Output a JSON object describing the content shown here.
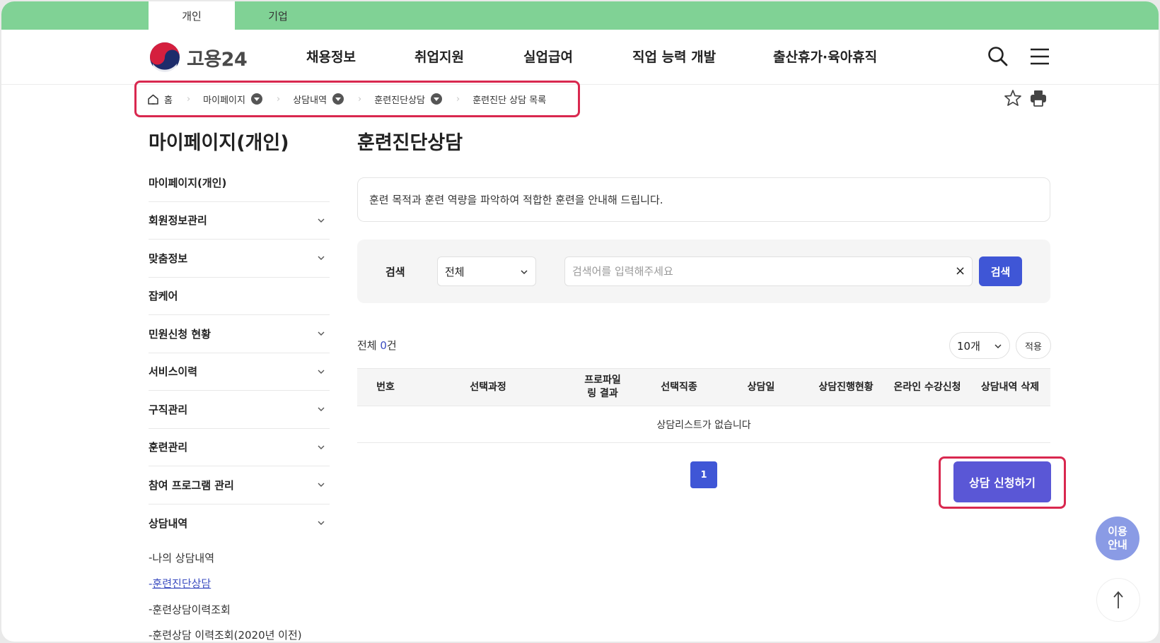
{
  "top_tabs": [
    "개인",
    "기업"
  ],
  "logo": {
    "text": "고용24"
  },
  "gnb": [
    "채용정보",
    "취업지원",
    "실업급여",
    "직업 능력 개발",
    "출산휴가·육아휴직"
  ],
  "breadcrumb": [
    "홈",
    "마이페이지",
    "상담내역",
    "훈련진단상담",
    "훈련진단 상담 목록"
  ],
  "sidebar": {
    "title": "마이페이지(개인)",
    "items": [
      {
        "label": "마이페이지(개인)"
      },
      {
        "label": "회원정보관리"
      },
      {
        "label": "맞춤정보"
      },
      {
        "label": "잡케어"
      },
      {
        "label": "민원신청 현황"
      },
      {
        "label": "서비스이력"
      },
      {
        "label": "구직관리"
      },
      {
        "label": "훈련관리"
      },
      {
        "label": "참여 프로그램 관리"
      },
      {
        "label": "상담내역"
      }
    ],
    "sub_items": [
      {
        "label": "나의 상담내역"
      },
      {
        "label": "훈련진단상담"
      },
      {
        "label": "훈련상담이력조회"
      },
      {
        "label": "훈련상담 이력조회(2020년 이전)"
      }
    ]
  },
  "main": {
    "title": "훈련진단상담",
    "description": "훈련 목적과 훈련 역량을 파악하여 적합한 훈련을 안내해 드립니다.",
    "search": {
      "label": "검색",
      "select_value": "전체",
      "placeholder": "검색어를 입력해주세요",
      "clear": "×",
      "button": "검색"
    },
    "count": {
      "prefix": "전체 ",
      "value": "0",
      "suffix": "건"
    },
    "per_page": "10개",
    "apply": "적용",
    "table": {
      "columns": [
        "번호",
        "선택과정",
        "프로파일링 결과",
        "선택직종",
        "상담일",
        "상담진행현황",
        "온라인 수강신청",
        "상담내역 삭제"
      ],
      "empty_message": "상담리스트가 없습니다"
    },
    "pagination": {
      "current": "1"
    },
    "consult_button": "상담 신청하기"
  },
  "floating": {
    "help_line1": "이용",
    "help_line2": "안내"
  }
}
